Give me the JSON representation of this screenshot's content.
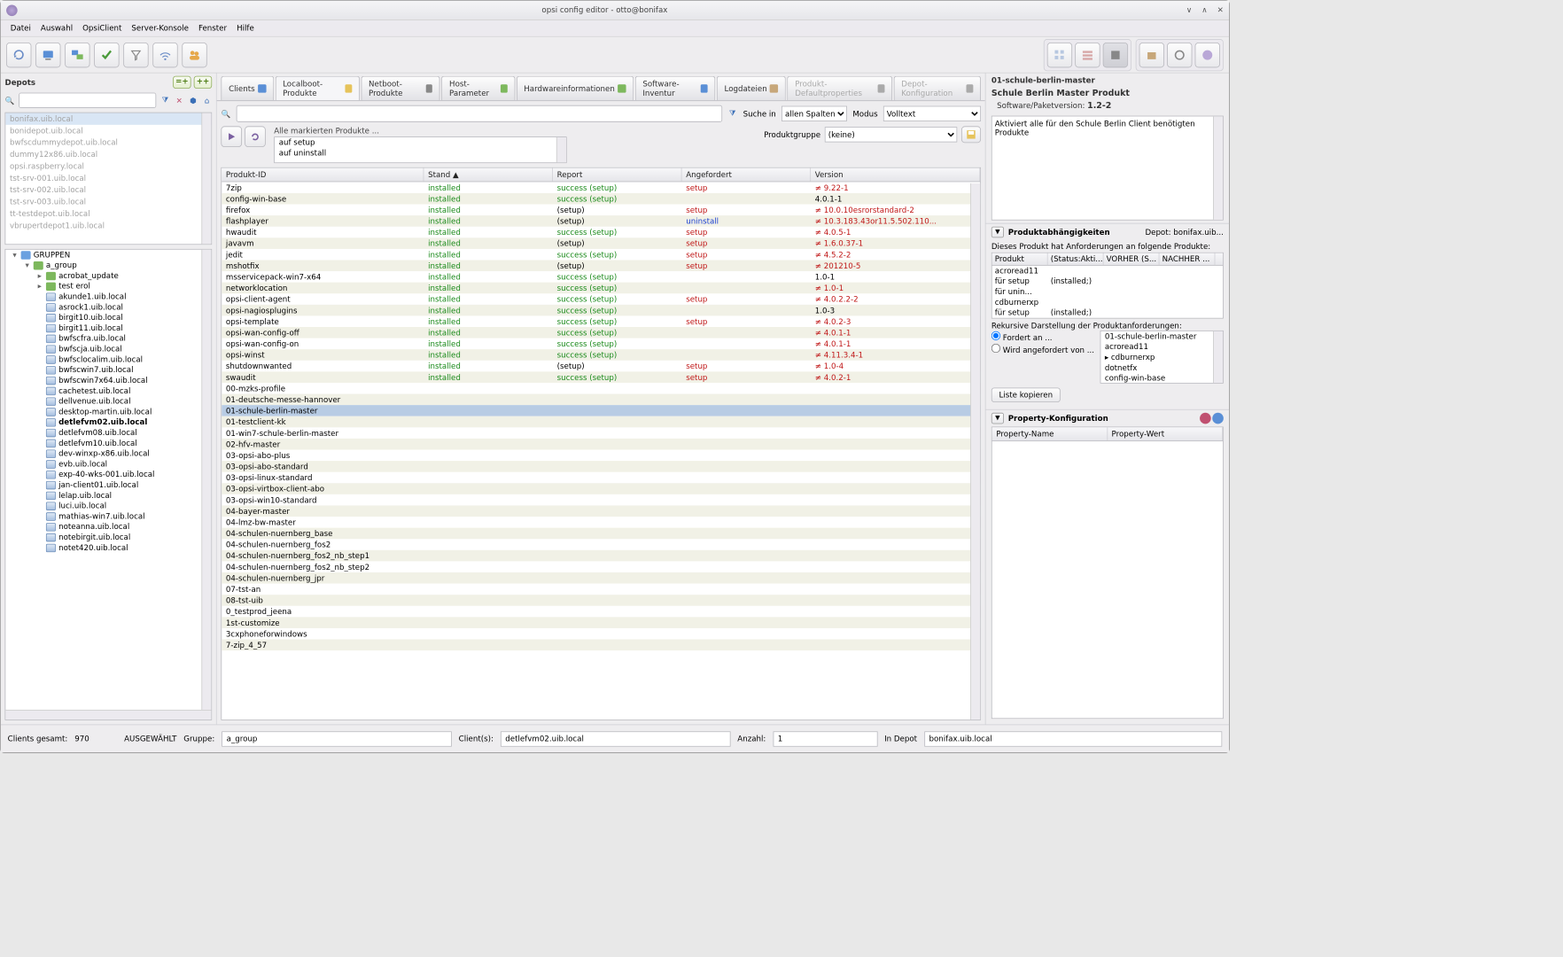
{
  "window": {
    "title": "opsi config editor - otto@bonifax"
  },
  "menu": [
    "Datei",
    "Auswahl",
    "OpsiClient",
    "Server-Konsole",
    "Fenster",
    "Hilfe"
  ],
  "depots": {
    "title": "Depots",
    "items": [
      {
        "label": "bonifax.uib.local",
        "sel": true
      },
      {
        "label": "bonidepot.uib.local"
      },
      {
        "label": "bwfscdummydepot.uib.local"
      },
      {
        "label": "dummy12x86.uib.local"
      },
      {
        "label": "opsi.raspberry.local"
      },
      {
        "label": "tst-srv-001.uib.local"
      },
      {
        "label": "tst-srv-002.uib.local"
      },
      {
        "label": "tst-srv-003.uib.local"
      },
      {
        "label": "tt-testdepot.uib.local"
      },
      {
        "label": "vbrupertdepot1.uib.local"
      }
    ]
  },
  "tree": [
    {
      "indent": 0,
      "tw": "▾",
      "label": "GRUPPEN",
      "icon": "folder"
    },
    {
      "indent": 1,
      "tw": "▾",
      "label": "a_group",
      "icon": "green"
    },
    {
      "indent": 2,
      "tw": "▸",
      "label": "acrobat_update",
      "icon": "green"
    },
    {
      "indent": 2,
      "tw": "▸",
      "label": "test erol",
      "icon": "green"
    },
    {
      "indent": 2,
      "tw": "",
      "label": "akunde1.uib.local",
      "icon": "pc"
    },
    {
      "indent": 2,
      "tw": "",
      "label": "asrock1.uib.local",
      "icon": "pc"
    },
    {
      "indent": 2,
      "tw": "",
      "label": "birgit10.uib.local",
      "icon": "pc"
    },
    {
      "indent": 2,
      "tw": "",
      "label": "birgit11.uib.local",
      "icon": "pc"
    },
    {
      "indent": 2,
      "tw": "",
      "label": "bwfscfra.uib.local",
      "icon": "pc"
    },
    {
      "indent": 2,
      "tw": "",
      "label": "bwfscja.uib.local",
      "icon": "pc"
    },
    {
      "indent": 2,
      "tw": "",
      "label": "bwfsclocalim.uib.local",
      "icon": "pc"
    },
    {
      "indent": 2,
      "tw": "",
      "label": "bwfscwin7.uib.local",
      "icon": "pc"
    },
    {
      "indent": 2,
      "tw": "",
      "label": "bwfscwin7x64.uib.local",
      "icon": "pc"
    },
    {
      "indent": 2,
      "tw": "",
      "label": "cachetest.uib.local",
      "icon": "pc"
    },
    {
      "indent": 2,
      "tw": "",
      "label": "dellvenue.uib.local",
      "icon": "pc"
    },
    {
      "indent": 2,
      "tw": "",
      "label": "desktop-martin.uib.local",
      "icon": "pc"
    },
    {
      "indent": 2,
      "tw": "",
      "label": "detlefvm02.uib.local",
      "icon": "pc",
      "bold": true
    },
    {
      "indent": 2,
      "tw": "",
      "label": "detlefvm08.uib.local",
      "icon": "pc"
    },
    {
      "indent": 2,
      "tw": "",
      "label": "detlefvm10.uib.local",
      "icon": "pc"
    },
    {
      "indent": 2,
      "tw": "",
      "label": "dev-winxp-x86.uib.local",
      "icon": "pc"
    },
    {
      "indent": 2,
      "tw": "",
      "label": "evb.uib.local",
      "icon": "pc"
    },
    {
      "indent": 2,
      "tw": "",
      "label": "exp-40-wks-001.uib.local",
      "icon": "pc"
    },
    {
      "indent": 2,
      "tw": "",
      "label": "jan-client01.uib.local",
      "icon": "pc"
    },
    {
      "indent": 2,
      "tw": "",
      "label": "lelap.uib.local",
      "icon": "pc"
    },
    {
      "indent": 2,
      "tw": "",
      "label": "luci.uib.local",
      "icon": "pc"
    },
    {
      "indent": 2,
      "tw": "",
      "label": "mathias-win7.uib.local",
      "icon": "pc"
    },
    {
      "indent": 2,
      "tw": "",
      "label": "noteanna.uib.local",
      "icon": "pc"
    },
    {
      "indent": 2,
      "tw": "",
      "label": "notebirgit.uib.local",
      "icon": "pc"
    },
    {
      "indent": 2,
      "tw": "",
      "label": "notet420.uib.local",
      "icon": "pc"
    }
  ],
  "tabs": [
    {
      "label": "Clients"
    },
    {
      "label": "Localboot-Produkte",
      "active": true
    },
    {
      "label": "Netboot-Produkte"
    },
    {
      "label": "Host-Parameter"
    },
    {
      "label": "Hardwareinformationen"
    },
    {
      "label": "Software-Inventur"
    },
    {
      "label": "Logdateien"
    },
    {
      "label": "Produkt-Defaultproperties",
      "disabled": true
    },
    {
      "label": "Depot-Konfiguration",
      "disabled": true
    }
  ],
  "search": {
    "suche_in": "Suche in",
    "suche_val": "allen Spalten",
    "modus": "Modus",
    "modus_val": "Volltext"
  },
  "marked": {
    "label": "Alle markierten Produkte ...",
    "items": [
      "auf setup",
      "auf uninstall"
    ]
  },
  "prodgrp": {
    "label": "Produktgruppe",
    "value": "(keine)"
  },
  "columns": [
    "Produkt-ID",
    "Stand",
    "Report",
    "Angefordert",
    "Version"
  ],
  "rows": [
    {
      "id": "7zip",
      "stand": "installed",
      "report": "success (setup)",
      "ang": "setup",
      "ver": "≠ 9.22-1",
      "vr": true
    },
    {
      "id": "config-win-base",
      "stand": "installed",
      "report": "success (setup)",
      "ang": "",
      "ver": "4.0.1-1"
    },
    {
      "id": "firefox",
      "stand": "installed",
      "report": "(setup)",
      "rg": false,
      "ang": "setup",
      "ver": "≠ 10.0.10esrorstandard-2",
      "vr": true
    },
    {
      "id": "flashplayer",
      "stand": "installed",
      "report": "(setup)",
      "rg": false,
      "ang": "uninstall",
      "ab": true,
      "ver": "≠ 10.3.183.43or11.5.502.110...",
      "vr": true
    },
    {
      "id": "hwaudit",
      "stand": "installed",
      "report": "success (setup)",
      "ang": "setup",
      "ver": "≠ 4.0.5-1",
      "vr": true
    },
    {
      "id": "javavm",
      "stand": "installed",
      "report": "(setup)",
      "rg": false,
      "ang": "setup",
      "ver": "≠ 1.6.0.37-1",
      "vr": true
    },
    {
      "id": "jedit",
      "stand": "installed",
      "report": "success (setup)",
      "ang": "setup",
      "ver": "≠ 4.5.2-2",
      "vr": true
    },
    {
      "id": "mshotfix",
      "stand": "installed",
      "report": "(setup)",
      "rg": false,
      "ang": "setup",
      "ver": "≠ 201210-5",
      "vr": true
    },
    {
      "id": "msservicepack-win7-x64",
      "stand": "installed",
      "report": "success (setup)",
      "ang": "",
      "ver": "1.0-1"
    },
    {
      "id": "networklocation",
      "stand": "installed",
      "report": "success (setup)",
      "ang": "",
      "ver": "≠ 1.0-1",
      "vr": true
    },
    {
      "id": "opsi-client-agent",
      "stand": "installed",
      "report": "success (setup)",
      "ang": "setup",
      "ver": "≠ 4.0.2.2-2",
      "vr": true
    },
    {
      "id": "opsi-nagiosplugins",
      "stand": "installed",
      "report": "success (setup)",
      "ang": "",
      "ver": "1.0-3"
    },
    {
      "id": "opsi-template",
      "stand": "installed",
      "report": "success (setup)",
      "ang": "setup",
      "ver": "≠ 4.0.2-3",
      "vr": true
    },
    {
      "id": "opsi-wan-config-off",
      "stand": "installed",
      "report": "success (setup)",
      "ang": "",
      "ver": "≠ 4.0.1-1",
      "vr": true
    },
    {
      "id": "opsi-wan-config-on",
      "stand": "installed",
      "report": "success (setup)",
      "ang": "",
      "ver": "≠ 4.0.1-1",
      "vr": true
    },
    {
      "id": "opsi-winst",
      "stand": "installed",
      "report": "success (setup)",
      "ang": "",
      "ver": "≠ 4.11.3.4-1",
      "vr": true
    },
    {
      "id": "shutdownwanted",
      "stand": "installed",
      "report": "(setup)",
      "rg": false,
      "ang": "setup",
      "ver": "≠ 1.0-4",
      "vr": true
    },
    {
      "id": "swaudit",
      "stand": "installed",
      "report": "success (setup)",
      "ang": "setup",
      "ver": "≠ 4.0.2-1",
      "vr": true
    },
    {
      "id": "00-mzks-profile"
    },
    {
      "id": "01-deutsche-messe-hannover"
    },
    {
      "id": "01-schule-berlin-master",
      "selected": true
    },
    {
      "id": "01-testclient-kk"
    },
    {
      "id": "01-win7-schule-berlin-master"
    },
    {
      "id": "02-hfv-master"
    },
    {
      "id": "03-opsi-abo-plus"
    },
    {
      "id": "03-opsi-abo-standard"
    },
    {
      "id": "03-opsi-linux-standard"
    },
    {
      "id": "03-opsi-virtbox-client-abo"
    },
    {
      "id": "03-opsi-win10-standard"
    },
    {
      "id": "04-bayer-master"
    },
    {
      "id": "04-lmz-bw-master"
    },
    {
      "id": "04-schulen-nuernberg_base"
    },
    {
      "id": "04-schulen-nuernberg_fos2"
    },
    {
      "id": "04-schulen-nuernberg_fos2_nb_step1"
    },
    {
      "id": "04-schulen-nuernberg_fos2_nb_step2"
    },
    {
      "id": "04-schulen-nuernberg_jpr"
    },
    {
      "id": "07-tst-an"
    },
    {
      "id": "08-tst-uib"
    },
    {
      "id": "0_testprod_jeena"
    },
    {
      "id": "1st-customize"
    },
    {
      "id": "3cxphoneforwindows"
    },
    {
      "id": "7-zip_4_57"
    }
  ],
  "right": {
    "id": "01-schule-berlin-master",
    "title": "Schule Berlin Master Produkt",
    "ver_lbl": "Software/Paketversion:",
    "ver": "1.2-2",
    "desc": "Aktiviert alle für den Schule Berlin Client benötigten Produkte",
    "dep_title": "Produktabhängigkeiten",
    "dep_depot": "Depot: bonifax.uib...",
    "dep_note": "Dieses Produkt hat Anforderungen an folgende Produkte:",
    "dep_cols": [
      "Produkt",
      "(Status:Akti...",
      "VORHER (S...",
      "NACHHER ..."
    ],
    "dep_rows": [
      {
        "p": "acroread11",
        "s": "",
        "v": "",
        "n": ""
      },
      {
        "p": "   für setup",
        "s": "(installed;)",
        "v": "",
        "n": ""
      },
      {
        "p": "   für unin...",
        "s": "",
        "v": "",
        "n": ""
      },
      {
        "p": "cdburnerxp",
        "s": "",
        "v": "",
        "n": ""
      },
      {
        "p": "   für setup",
        "s": "(installed;)",
        "v": "",
        "n": ""
      }
    ],
    "rec_lbl": "Rekursive Darstellung der Produktanforderungen:",
    "radio1": "Fordert an ...",
    "radio2": "Wird angefordert von ...",
    "rec_items": [
      "01-schule-berlin-master",
      "   acroread11",
      "▸ cdburnerxp",
      "   dotnetfx",
      "   config-win-base"
    ],
    "copy_btn": "Liste kopieren",
    "prop_title": "Property-Konfiguration",
    "prop_cols": [
      "Property-Name",
      "Property-Wert"
    ]
  },
  "status": {
    "clients_lbl": "Clients gesamt:",
    "clients": "970",
    "sel_lbl": "AUSGEWÄHLT",
    "grp_lbl": "Gruppe:",
    "grp": "a_group",
    "cli_lbl": "Client(s):",
    "cli": "detlefvm02.uib.local",
    "anz_lbl": "Anzahl:",
    "anz": "1",
    "depot_lbl": "In Depot",
    "depot": "bonifax.uib.local"
  }
}
